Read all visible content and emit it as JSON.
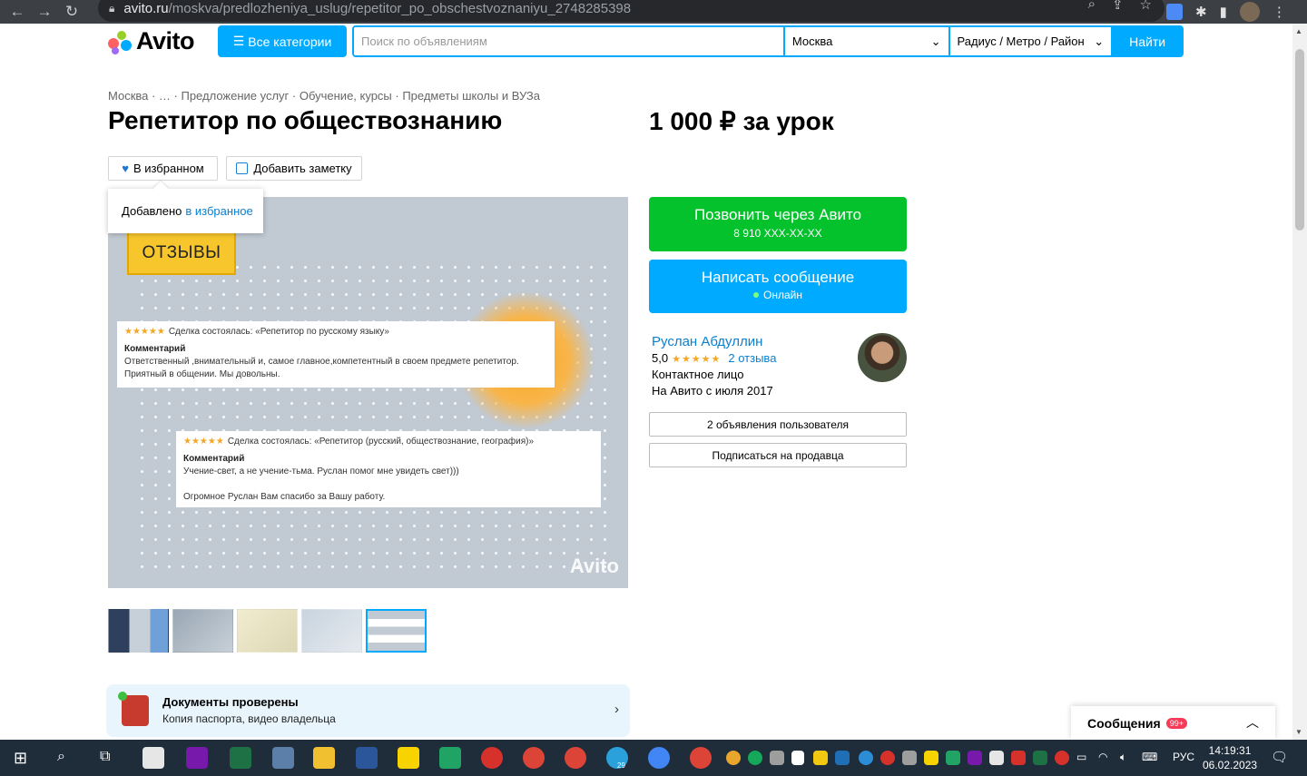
{
  "browser": {
    "url_domain": "avito.ru",
    "url_path": "/moskva/predlozheniya_uslug/repetitor_po_obschestvoznaniyu_2748285398"
  },
  "header": {
    "logo_text": "Avito",
    "categories_label": "Все категории",
    "search_placeholder": "Поиск по объявлениям",
    "city": "Москва",
    "radius": "Радиус / Метро / Район",
    "search_button": "Найти"
  },
  "breadcrumb": "Москва · … · Предложение услуг · Обучение, курсы · Предметы школы и ВУЗа",
  "listing": {
    "title": "Репетитор по обществознанию",
    "price": "1 000 ₽ за урок",
    "favorite_label": "В избранном",
    "note_label": "Добавить заметку",
    "tooltip_text": "Добавлено",
    "tooltip_link": "в избранное"
  },
  "photo": {
    "badge": "ОТЗЫВЫ",
    "review1": {
      "stars": "★★★★★",
      "deal": "Сделка состоялась: «Репетитор по русскому языку»",
      "heading": "Комментарий",
      "text": "Ответственный ,внимательный и, самое главное,компетентный в своем предмете репетитор. Приятный в общении. Мы довольны."
    },
    "review2": {
      "stars": "★★★★★",
      "deal": "Сделка состоялась: «Репетитор (русский, обществознание, география)»",
      "heading": "Комментарий",
      "text1": "Учение-свет, а не учение-тьма. Руслан помог мне увидеть свет)))",
      "text2": "Огромное Руслан Вам спасибо за Вашу работу."
    },
    "watermark": "Avito"
  },
  "docs": {
    "title": "Документы проверены",
    "subtitle": "Копия паспорта, видео владельца"
  },
  "contact": {
    "call_label": "Позвонить через Авито",
    "phone": "8 910 XXX-XX-XX",
    "message_label": "Написать сообщение",
    "online": "Онлайн"
  },
  "seller": {
    "name": "Руслан Абдуллин",
    "rating": "5,0",
    "stars": "★★★★★",
    "reviews": "2 отзыва",
    "role": "Контактное лицо",
    "since": "На Авито с июля 2017",
    "ads_button": "2 объявления пользователя",
    "subscribe_button": "Подписаться на продавца"
  },
  "messages": {
    "label": "Сообщения",
    "count": "99+"
  },
  "taskbar": {
    "lang": "РУС",
    "time": "14:19:31",
    "date": "06.02.2023",
    "badge_29": "29"
  },
  "colors": {
    "accent": "#00aaff",
    "call_green": "#04c22b",
    "link": "#0a80d0",
    "star": "#f5a623"
  }
}
